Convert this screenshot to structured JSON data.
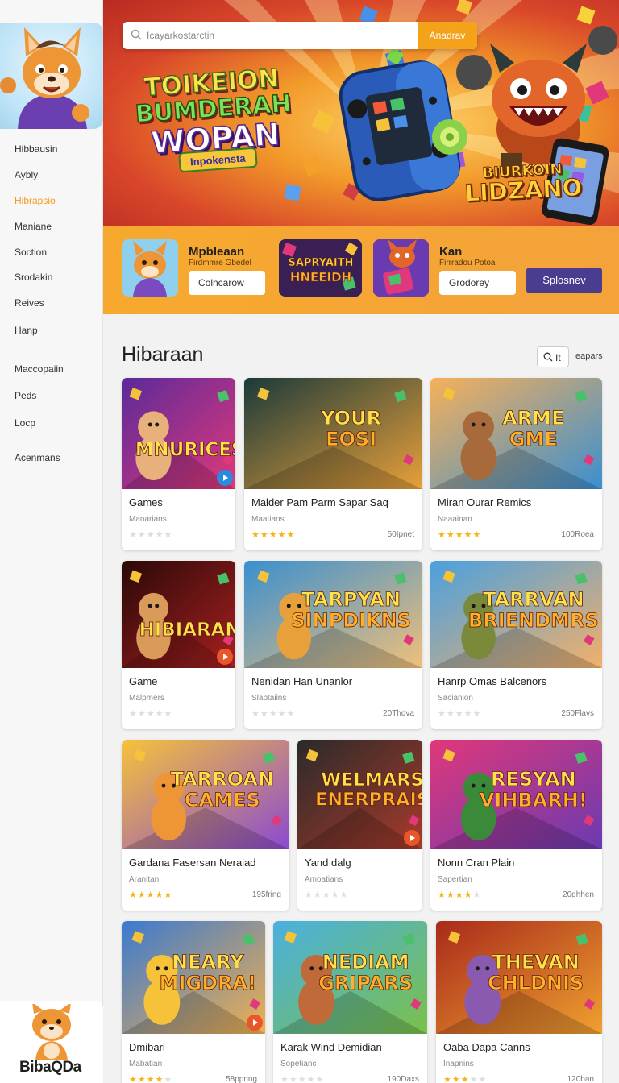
{
  "sidebar": {
    "items": [
      {
        "label": "Hibbausin",
        "active": false
      },
      {
        "label": "Aybly",
        "active": false
      },
      {
        "label": "Hibrapsio",
        "active": true
      },
      {
        "label": "Maniane",
        "active": false
      },
      {
        "label": "Soction",
        "active": false
      },
      {
        "label": "Srodakin",
        "active": false
      },
      {
        "label": "Reives",
        "active": false
      },
      {
        "label": "Hanp",
        "active": false
      },
      {
        "label": "Maccopaiin",
        "active": false
      },
      {
        "label": "Peds",
        "active": false
      },
      {
        "label": "Locp",
        "active": false
      },
      {
        "label": "Acenmans",
        "active": false
      }
    ],
    "logo_text": "BibaQDa"
  },
  "hero": {
    "search_placeholder": "Icayarkostarctin",
    "search_button": "Anadrav",
    "title_line1": "TOIKEION",
    "title_line2": "BUMDERAH",
    "title_line3": "WOPAN",
    "subtitle": "Inpokensta",
    "right_line1": "BIURKOIN",
    "right_line2": "LIDZANO"
  },
  "promo": {
    "left_title": "Mpbleaan",
    "left_subtitle": "Firdmmre Gbedel",
    "left_input": "Colncarow",
    "center_art_line1": "SAPRYAITH",
    "center_art_line2": "HNEEIDH",
    "right_title": "Kan",
    "right_subtitle": "Firrradou Potoa",
    "right_input": "Grodorey",
    "right_button": "Splosnev"
  },
  "section": {
    "title": "Hibaraan",
    "search_text": "It",
    "link": "eapars"
  },
  "cards": [
    {
      "title": "Games",
      "subtitle": "Manarians",
      "rating": 0,
      "count": "",
      "art": "MNURICES"
    },
    {
      "title": "Malder Pam Parm Sapar Saq",
      "subtitle": "Maatians",
      "rating": 5,
      "count": "50Ipnet",
      "art": "YOUR EOSI"
    },
    {
      "title": "Miran Ourar Remics",
      "subtitle": "Naaainan",
      "rating": 5,
      "count": "100Roea",
      "art": "ARME GME"
    },
    {
      "title": "Game",
      "subtitle": "Malpmers",
      "rating": 0,
      "count": "",
      "art": "HIBIARAN"
    },
    {
      "title": "Nenidan Han Unanlor",
      "subtitle": "Slaptaiins",
      "rating": 0,
      "count": "20Thdva",
      "art": "TARPYAN SINPDIKNS"
    },
    {
      "title": "Hanrp Omas Balcenors",
      "subtitle": "Sacianion",
      "rating": 0,
      "count": "250Flavs",
      "art": "TARRVAN BRIENDMRS"
    },
    {
      "title": "Gardana Fasersan Neraiad",
      "subtitle": "Aranitan",
      "rating": 5,
      "count": "195fring",
      "art": "TARROAN CAMES"
    },
    {
      "title": "Yand dalg",
      "subtitle": "Amoatians",
      "rating": 0,
      "count": "",
      "art": "WELMARS ENERPRAIS"
    },
    {
      "title": "Nonn Cran Plain",
      "subtitle": "Sapertian",
      "rating": 4,
      "count": "20ghhen",
      "art": "RESYAN VIHBARH!"
    },
    {
      "title": "Dmibari",
      "subtitle": "Mabatian",
      "rating": 4,
      "count": "58ppring",
      "art": "NEARY MIGDRA!"
    },
    {
      "title": "Karak Wind Demidian",
      "subtitle": "Sopetianc",
      "rating": 0,
      "count": "190Daxs",
      "art": "NEDIAM GRIPARS"
    },
    {
      "title": "Oaba Dapa Canns",
      "subtitle": "Inapnins",
      "rating": 3,
      "count": "120ban",
      "art": "THEVAN CHLDNIS"
    }
  ]
}
